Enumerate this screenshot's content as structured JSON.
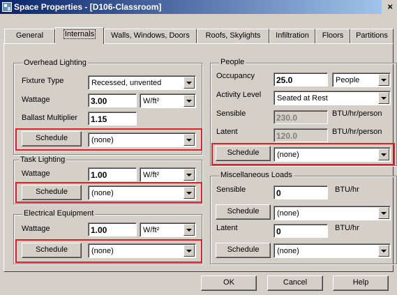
{
  "window": {
    "title": "Space Properties - [D106-Classroom]",
    "close": "×"
  },
  "tabs": [
    {
      "label": "General"
    },
    {
      "label": "Internals"
    },
    {
      "label": "Walls, Windows, Doors"
    },
    {
      "label": "Roofs, Skylights"
    },
    {
      "label": "Infiltration"
    },
    {
      "label": "Floors"
    },
    {
      "label": "Partitions"
    }
  ],
  "overhead": {
    "title": "Overhead Lighting",
    "fixture_label": "Fixture Type",
    "fixture_value": "Recessed, unvented",
    "wattage_label": "Wattage",
    "wattage_value": "3.00",
    "wattage_unit": "W/ft²",
    "ballast_label": "Ballast Multiplier",
    "ballast_value": "1.15",
    "schedule_button": "Schedule",
    "schedule_value": "(none)"
  },
  "task": {
    "title": "Task Lighting",
    "wattage_label": "Wattage",
    "wattage_value": "1.00",
    "wattage_unit": "W/ft²",
    "schedule_button": "Schedule",
    "schedule_value": "(none)"
  },
  "equipment": {
    "title": "Electrical Equipment",
    "wattage_label": "Wattage",
    "wattage_value": "1.00",
    "wattage_unit": "W/ft²",
    "schedule_button": "Schedule",
    "schedule_value": "(none)"
  },
  "people": {
    "title": "People",
    "occupancy_label": "Occupancy",
    "occupancy_value": "25.0",
    "occupancy_unit": "People",
    "activity_label": "Activity Level",
    "activity_value": "Seated at Rest",
    "sensible_label": "Sensible",
    "sensible_value": "230.0",
    "sensible_unit": "BTU/hr/person",
    "latent_label": "Latent",
    "latent_value": "120.0",
    "latent_unit": "BTU/hr/person",
    "schedule_button": "Schedule",
    "schedule_value": "(none)"
  },
  "misc": {
    "title": "Miscellaneous Loads",
    "sensible_label": "Sensible",
    "sensible_value": "0",
    "sensible_unit": "BTU/hr",
    "sensible_schedule_button": "Schedule",
    "sensible_schedule_value": "(none)",
    "latent_label": "Latent",
    "latent_value": "0",
    "latent_unit": "BTU/hr",
    "latent_schedule_button": "Schedule",
    "latent_schedule_value": "(none)"
  },
  "buttons": {
    "ok": "OK",
    "cancel": "Cancel",
    "help": "Help"
  },
  "colors": {
    "highlight": "#e41e26",
    "titlebar": "#0a246a",
    "face": "#d4d0c8"
  }
}
